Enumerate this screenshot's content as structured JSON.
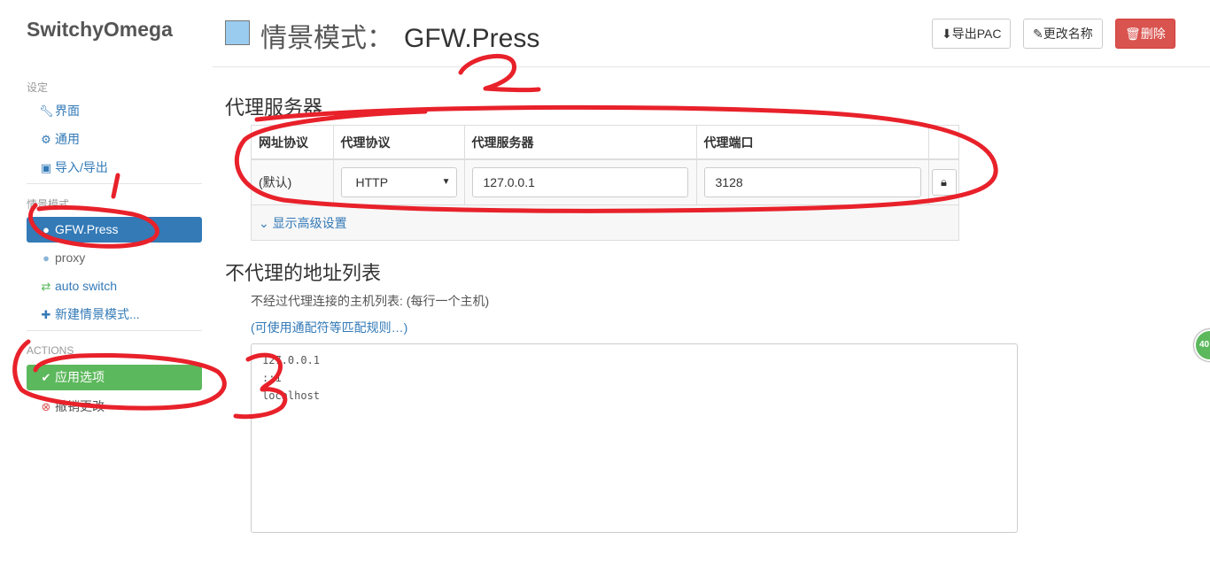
{
  "app": {
    "brand": "SwitchyOmega"
  },
  "sidebar": {
    "settings_label": "设定",
    "settings_items": [
      {
        "label": "界面",
        "icon": "wrench-icon"
      },
      {
        "label": "通用",
        "icon": "gear-icon"
      },
      {
        "label": "导入/导出",
        "icon": "floppy-icon"
      }
    ],
    "profiles_label": "情景模式",
    "profiles": [
      {
        "label": "GFW.Press",
        "icon": "globe-icon",
        "active": true
      },
      {
        "label": "proxy",
        "icon": "globe-icon"
      },
      {
        "label": "auto switch",
        "icon": "switch-icon"
      },
      {
        "label": "新建情景模式...",
        "icon": "plus-icon"
      }
    ],
    "actions_label": "ACTIONS",
    "apply_label": "应用选项",
    "discard_label": "撤销更改"
  },
  "header": {
    "title_label": "情景模式：",
    "profile_name": "GFW.Press",
    "export_pac": "导出PAC",
    "rename": "更改名称",
    "delete": "删除",
    "swatch_color": "#99ccee"
  },
  "proxy_section": {
    "title": "代理服务器",
    "columns": [
      "网址协议",
      "代理协议",
      "代理服务器",
      "代理端口"
    ],
    "row": {
      "scheme": "(默认)",
      "protocol": "HTTP",
      "server": "127.0.0.1",
      "port": "3128"
    },
    "advanced_link": "显示高级设置"
  },
  "bypass_section": {
    "title": "不代理的地址列表",
    "description": "不经过代理连接的主机列表: (每行一个主机)",
    "wildcard_link": "(可使用通配符等匹配规则…)",
    "list": "127.0.0.1\n::1\nlocalhost"
  },
  "badge": {
    "text": "40"
  },
  "annotations": {
    "color": "#e8212a",
    "marks": [
      "1",
      "2",
      "3"
    ]
  }
}
